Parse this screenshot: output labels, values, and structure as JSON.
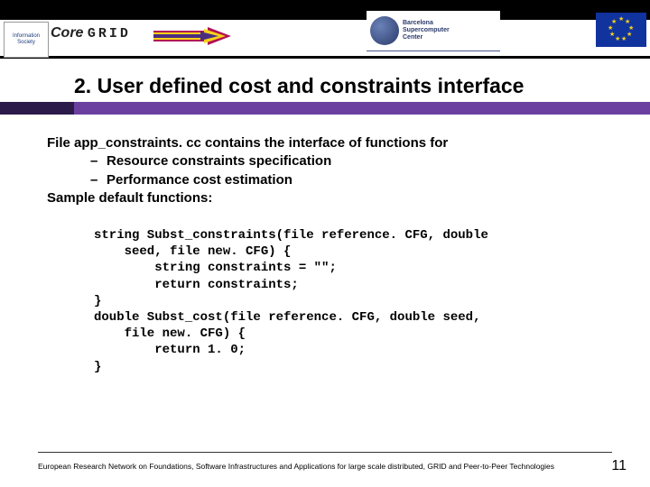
{
  "header": {
    "infosoc_label": "Information Society",
    "coregrid_core": "Core",
    "coregrid_grid": "GRID",
    "bsc_line1": "Barcelona",
    "bsc_line2": "Supercomputer",
    "bsc_line3": "Center"
  },
  "title": "2.   User defined cost and constraints interface",
  "body": {
    "line1": "File app_constraints. cc contains the interface of  functions for",
    "sub1": "Resource constraints specification",
    "sub2": "Performance cost estimation",
    "line2": "Sample default functions:"
  },
  "code": "string Subst_constraints(file reference. CFG, double\n    seed, file new. CFG) {\n        string constraints = \"\";\n        return constraints;\n}\ndouble Subst_cost(file reference. CFG, double seed,\n    file new. CFG) {\n        return 1. 0;\n}",
  "footer": "European Research Network on Foundations, Software Infrastructures and Applications for large scale distributed, GRID and Peer-to-Peer Technologies",
  "page_number": "11"
}
